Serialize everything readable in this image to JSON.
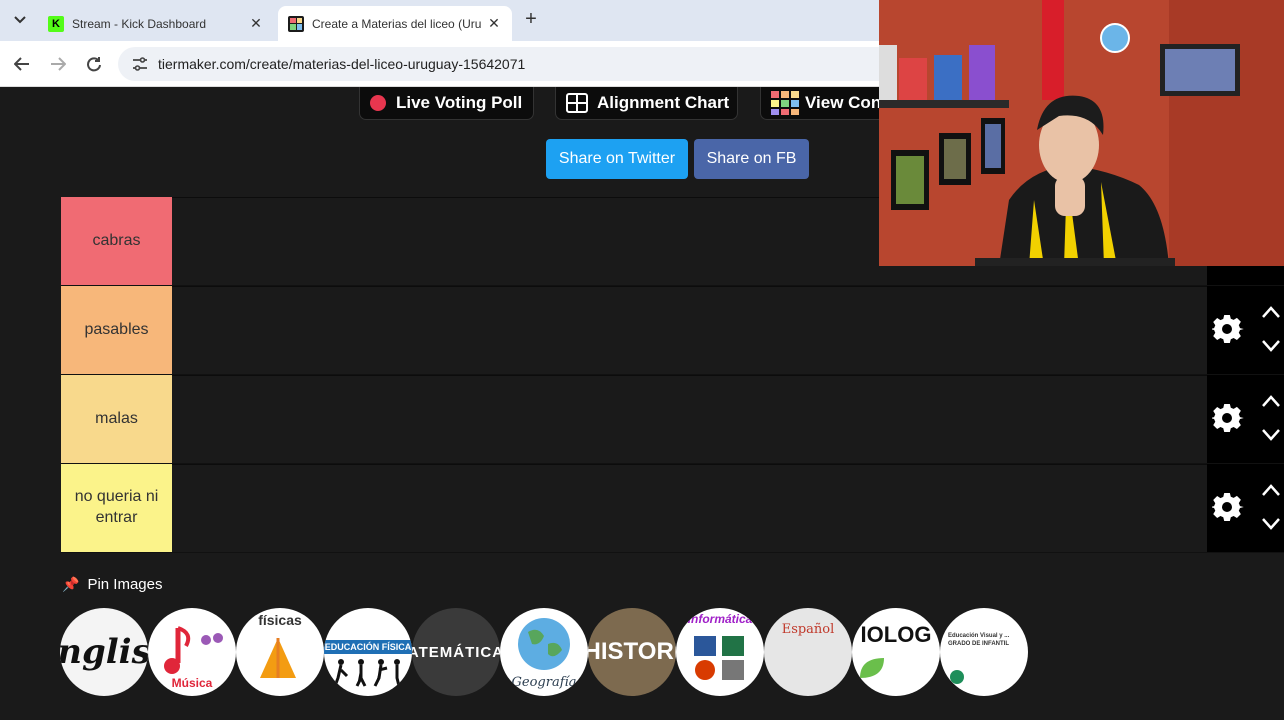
{
  "browser": {
    "tabs": [
      {
        "title": "Stream - Kick Dashboard",
        "favicon_color": "#53fc18"
      },
      {
        "title": "Create a Materias del liceo (Uru",
        "favicon_color": "#1b1b1b"
      }
    ],
    "url": "tiermaker.com/create/materias-del-liceo-uruguay-15642071"
  },
  "page": {
    "top_buttons": {
      "live_voting": "Live Voting Poll",
      "alignment": "Alignment Chart",
      "view": "View Con"
    },
    "share": {
      "twitter": "Share on Twitter",
      "facebook": "Share on FB",
      "twitter_color": "#1da1f2",
      "facebook_color": "#3b5998"
    },
    "tiers": [
      {
        "label": "cabras",
        "color": "#f06b73"
      },
      {
        "label": "pasables",
        "color": "#f7b77a"
      },
      {
        "label": "malas",
        "color": "#f8d98c"
      },
      {
        "label": "no queria ni entrar",
        "color": "#fbf38a"
      }
    ],
    "pin_images_label": "Pin Images",
    "images": [
      {
        "text": "nglis",
        "name": "english"
      },
      {
        "text": "Música",
        "name": "musica"
      },
      {
        "text": "físicas",
        "name": "ciencias-fisicas"
      },
      {
        "text": "EDUCACIÓN FÍSICA",
        "name": "educacion-fisica"
      },
      {
        "text": "ATEMÁTICA",
        "name": "matematica"
      },
      {
        "text": "Geografía",
        "name": "geografia"
      },
      {
        "text": "HISTORI",
        "name": "historia"
      },
      {
        "text": "Informática",
        "name": "informatica"
      },
      {
        "text": "Español",
        "name": "espanol"
      },
      {
        "text": "IOLOG",
        "name": "biologia"
      },
      {
        "text": "Educación Visual y ... GRADO DE INFANTIL",
        "name": "educacion-visual"
      }
    ]
  }
}
